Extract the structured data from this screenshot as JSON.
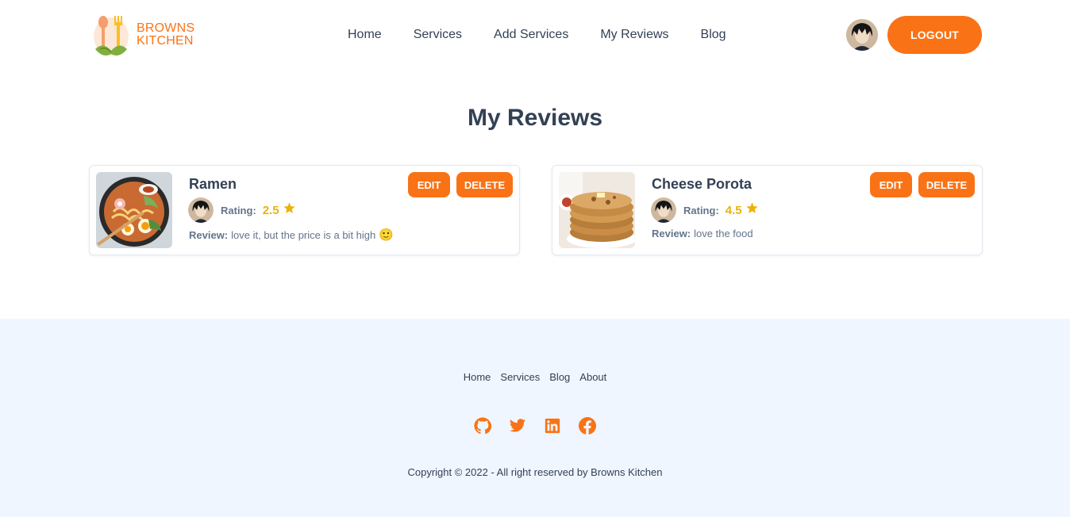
{
  "brand": {
    "line1": "BROWNS",
    "line2": "KITCHEN",
    "accent": "#f97316"
  },
  "nav": {
    "links": [
      "Home",
      "Services",
      "Add Services",
      "My Reviews",
      "Blog"
    ],
    "logout_label": "LOGOUT",
    "avatar_icon": "user-avatar"
  },
  "page": {
    "title": "My Reviews"
  },
  "reviews": [
    {
      "title": "Ramen",
      "rating_label": "Rating:",
      "rating": "2.5",
      "review_label": "Review:",
      "review_text": "love it, but the price is a bit high",
      "emoji": "🙂",
      "edit_label": "EDIT",
      "delete_label": "DELETE",
      "image_icon": "ramen-bowl-image"
    },
    {
      "title": "Cheese Porota",
      "rating_label": "Rating:",
      "rating": "4.5",
      "review_label": "Review:",
      "review_text": "love the food",
      "emoji": "",
      "edit_label": "EDIT",
      "delete_label": "DELETE",
      "image_icon": "flatbread-stack-image"
    }
  ],
  "footer": {
    "links": [
      "Home",
      "Services",
      "Blog",
      "About"
    ],
    "socials": [
      "github-icon",
      "twitter-icon",
      "linkedin-icon",
      "facebook-icon"
    ],
    "copyright": "Copyright © 2022 - All right reserved by Browns Kitchen"
  }
}
